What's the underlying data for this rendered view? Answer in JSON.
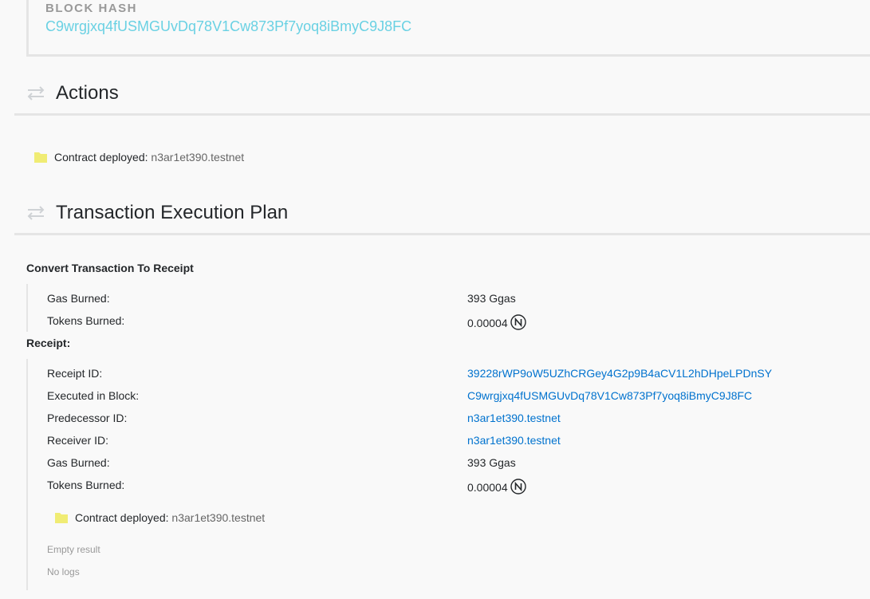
{
  "block": {
    "label": "BLOCK HASH",
    "hash": "C9wrgjxq4fUSMGUvDq78V1Cw873Pf7yoq8iBmyC9J8FC"
  },
  "actions_section": {
    "title": "Actions",
    "item": {
      "label": "Contract deployed:",
      "account": "n3ar1et390.testnet"
    }
  },
  "plan_section": {
    "title": "Transaction Execution Plan",
    "convert": {
      "title": "Convert Transaction To Receipt",
      "rows": [
        {
          "key": "Gas Burned:",
          "value": "393 Ggas"
        },
        {
          "key": "Tokens Burned:",
          "value": "0.00004"
        }
      ]
    },
    "receipt": {
      "title": "Receipt:",
      "rows": [
        {
          "key": "Receipt ID:",
          "value": "39228rWP9oW5UZhCRGey4G2p9B4aCV1L2hDHpeLPDnSY"
        },
        {
          "key": "Executed in Block:",
          "value": "C9wrgjxq4fUSMGUvDq78V1Cw873Pf7yoq8iBmyC9J8FC"
        },
        {
          "key": "Predecessor ID:",
          "value": "n3ar1et390.testnet"
        },
        {
          "key": "Receiver ID:",
          "value": "n3ar1et390.testnet"
        },
        {
          "key": "Gas Burned:",
          "value": "393 Ggas"
        },
        {
          "key": "Tokens Burned:",
          "value": "0.00004"
        }
      ],
      "action": {
        "label": "Contract deployed:",
        "account": "n3ar1et390.testnet"
      },
      "result": "Empty result",
      "logs": "No logs"
    }
  },
  "icons": {
    "section": "transfer-arrows-icon",
    "action": "folder-icon",
    "token": "near-logo-icon"
  },
  "colors": {
    "link": "#0072ce",
    "block_hash": "#6ad1e3",
    "folder": "#f0ec74"
  }
}
